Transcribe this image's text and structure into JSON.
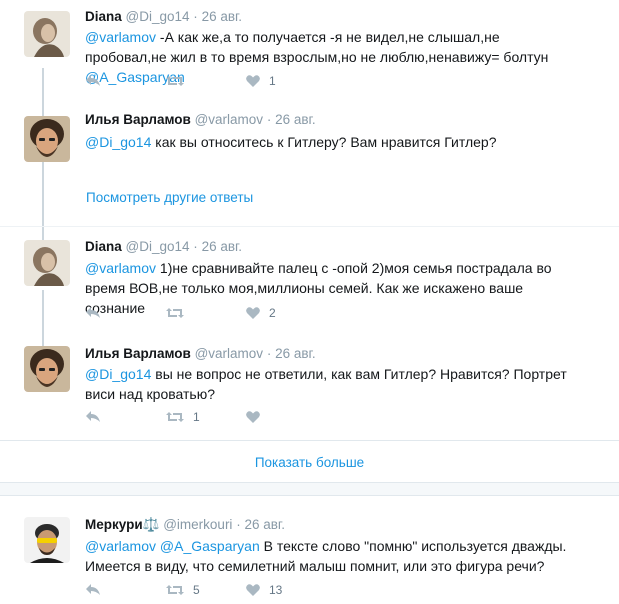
{
  "tweets": [
    {
      "name": "Diana",
      "handle": "@Di_go14",
      "sep": "·",
      "date": "26 авг.",
      "mention1": "@varlamov",
      "text1": " -А как же,а то получается -я не видел,не слышал,не пробовал,не жил в то время взрослым,но не люблю,ненавижу= болтун ",
      "mention2": "@A_Gasparyan",
      "retweets": "",
      "likes": "1"
    },
    {
      "name": "Илья Варламов",
      "handle": "@varlamov",
      "sep": "·",
      "date": "26 авг.",
      "mention1": "@Di_go14",
      "text1": " как вы относитесь к Гитлеру? Вам нравится Гитлер?"
    },
    {
      "name": "Diana",
      "handle": "@Di_go14",
      "sep": "·",
      "date": "26 авг.",
      "mention1": "@varlamov",
      "text1": " 1)не сравнивайте палец с -опой 2)моя семья пострадала во время ВОВ,не только моя,миллионы семей. Как же искажено ваше сознание",
      "retweets": "",
      "likes": "2"
    },
    {
      "name": "Илья Варламов",
      "handle": "@varlamov",
      "sep": "·",
      "date": "26 авг.",
      "mention1": "@Di_go14",
      "text1": " вы не вопрос не ответили, как вам Гитлер? Нравится? Портрет виси над кроватью?",
      "retweets": "1",
      "likes": ""
    },
    {
      "name": "Меркури⚖️",
      "handle": "@imerkouri",
      "sep": "·",
      "date": "26 авг.",
      "mention1": "@varlamov",
      "mention2": "@A_Gasparyan",
      "text1": " В тексте слово \"помню\" используется дважды. Имеется в виду, что семилетний малыш помнит, или это фигура речи?",
      "retweets": "5",
      "likes": "13"
    }
  ],
  "more_replies_label": "Посмотреть другие ответы",
  "show_more_label": "Показать больше",
  "colors": {
    "link": "#1b95e0",
    "muted": "#8899a6",
    "icon": "#aab8c2"
  }
}
